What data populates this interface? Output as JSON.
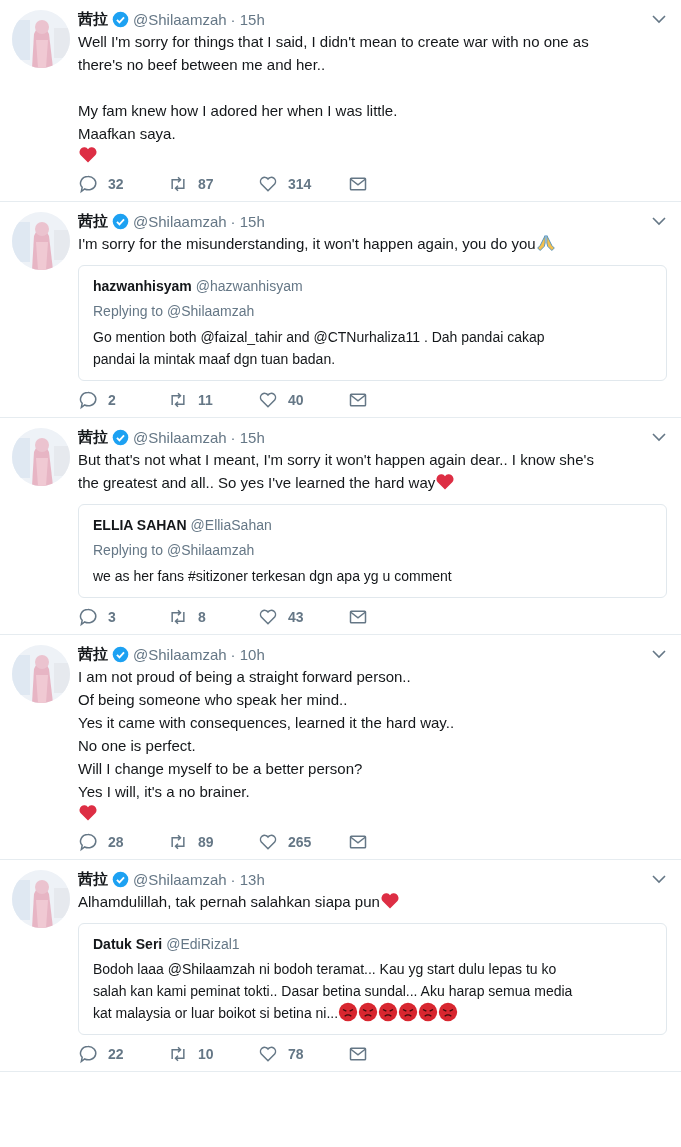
{
  "tweets": [
    {
      "name": "茜拉",
      "handle": "@Shilaamzah",
      "time": "· 15h",
      "paragraphs": [
        "Well I'm sorry for things that I said, I didn't mean to create war with no one as\nthere's no beef between me and her..",
        "My fam knew how I adored her when I was little.\nMaafkan saya."
      ],
      "emoji_line": [
        {
          "kind": "heart"
        }
      ],
      "replies": "32",
      "retweets": "87",
      "likes": "314"
    },
    {
      "name": "茜拉",
      "handle": "@Shilaamzah",
      "time": "· 15h",
      "paragraphs": [
        "I'm sorry for the misunderstanding, it won't happen again, you do you"
      ],
      "emoji_after": [
        {
          "kind": "pray"
        }
      ],
      "quote": {
        "name": "hazwanhisyam",
        "handle": "@hazwanhisyam",
        "replying": "Replying to @Shilaamzah",
        "text": "Go mention both @faizal_tahir and @CTNurhaliza11 . Dah pandai cakap\npandai la mintak maaf dgn tuan badan."
      },
      "replies": "2",
      "retweets": "11",
      "likes": "40"
    },
    {
      "name": "茜拉",
      "handle": "@Shilaamzah",
      "time": "· 15h",
      "paragraphs": [
        "But that's not what I meant, I'm sorry it won't happen again dear.. I know she's\nthe greatest and all.. So yes I've learned the hard way"
      ],
      "emoji_after": [
        {
          "kind": "heart"
        }
      ],
      "quote": {
        "name": "ELLIA SAHAN",
        "handle": "@ElliaSahan",
        "replying": "Replying to @Shilaamzah",
        "text": "we as her fans #sitizoner terkesan dgn apa yg u comment"
      },
      "replies": "3",
      "retweets": "8",
      "likes": "43"
    },
    {
      "name": "茜拉",
      "handle": "@Shilaamzah",
      "time": "· 10h",
      "paragraphs": [
        "I am not proud of being a straight forward person..\nOf being someone who speak her mind..\nYes it came with consequences, learned it the hard way..\nNo one is perfect.\nWill I change myself to be a better person?\nYes I will, it's a no brainer."
      ],
      "emoji_line": [
        {
          "kind": "heart"
        }
      ],
      "replies": "28",
      "retweets": "89",
      "likes": "265"
    },
    {
      "name": "茜拉",
      "handle": "@Shilaamzah",
      "time": "· 13h",
      "paragraphs": [
        "Alhamdulillah, tak pernah salahkan siapa pun"
      ],
      "emoji_after": [
        {
          "kind": "heart"
        }
      ],
      "quote": {
        "name": "Datuk Seri",
        "handle": "@EdiRizal1",
        "text": "Bodoh laaa @Shilaamzah ni bodoh teramat... Kau yg start dulu lepas tu ko\nsalah kan kami peminat tokti.. Dasar betina sundal... Aku harap semua media\nkat malaysia or luar boikot si betina ni...",
        "emoji_after": [
          {
            "kind": "angry"
          },
          {
            "kind": "angry"
          },
          {
            "kind": "angry"
          },
          {
            "kind": "angry"
          },
          {
            "kind": "angry"
          },
          {
            "kind": "angry"
          }
        ]
      },
      "replies": "22",
      "retweets": "10",
      "likes": "78"
    }
  ]
}
